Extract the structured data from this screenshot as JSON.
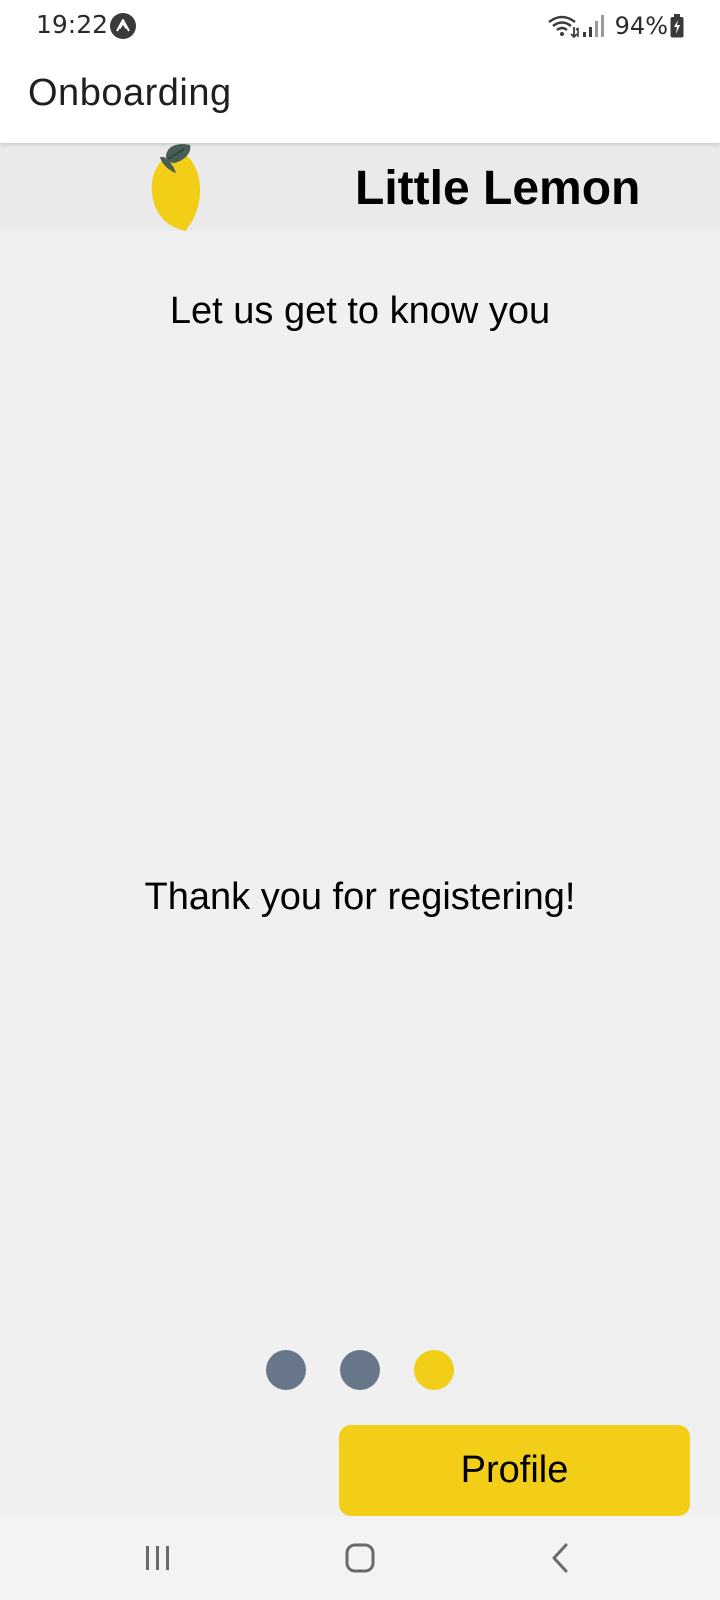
{
  "status_bar": {
    "time": "19:22",
    "battery": "94%",
    "icons": [
      "expo-icon",
      "wifi-icon",
      "signal-icon",
      "battery-charging-icon"
    ]
  },
  "app_bar": {
    "title": "Onboarding"
  },
  "brand": {
    "name": "Little Lemon",
    "logo_icon": "lemon-icon"
  },
  "content": {
    "heading": "Let us get to know you",
    "message": "Thank you for registering!"
  },
  "pager": {
    "page_count": 3,
    "active_index": 2
  },
  "actions": {
    "primary_label": "Profile"
  },
  "nav_bar": {
    "icons": [
      "recent-apps-icon",
      "home-icon",
      "back-icon"
    ]
  },
  "colors": {
    "accent": "#f2ce19",
    "dot_inactive": "#677789",
    "background": "#f0f0f0",
    "header_band": "#e9eae9",
    "leaf": "#495e57"
  }
}
